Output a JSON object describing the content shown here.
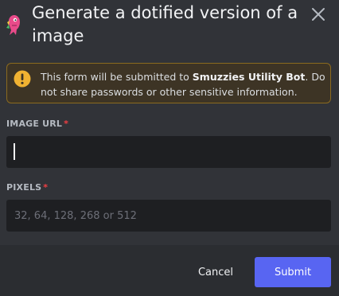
{
  "modal": {
    "title": "Generate a dotified version of a image",
    "close_icon": "close-icon",
    "bot_avatar_icon": "bot-avatar-icon"
  },
  "notice": {
    "icon": "warning-icon",
    "text_before": "This form will be submitted to ",
    "bot_name": "Smuzzies Utility Bot",
    "text_after": ". Do not share passwords or other sensitive information."
  },
  "fields": {
    "image_url": {
      "label": "IMAGE URL",
      "required_marker": "*",
      "value": "",
      "placeholder": ""
    },
    "pixels": {
      "label": "PIXELS",
      "required_marker": "*",
      "value": "",
      "placeholder": "32, 64, 128, 268 or 512"
    }
  },
  "footer": {
    "cancel_label": "Cancel",
    "submit_label": "Submit"
  },
  "colors": {
    "background": "#313338",
    "footer": "#2b2d31",
    "input": "#1e1f22",
    "accent": "#5865f2",
    "warning_border": "#8b6a1f",
    "warning_icon": "#f0b232",
    "required": "#f23f43"
  }
}
